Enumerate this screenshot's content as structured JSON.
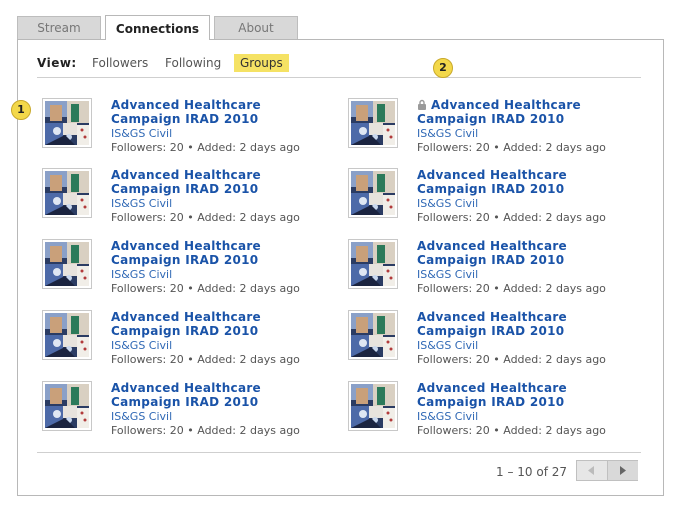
{
  "tabs": [
    "Stream",
    "Connections",
    "About"
  ],
  "view": {
    "label": "View:",
    "filters": [
      "Followers",
      "Following",
      "Groups"
    ],
    "active_filter": "Groups"
  },
  "badges": [
    "1",
    "2"
  ],
  "groups": [
    {
      "title": "Advanced Healthcare Campaign IRAD 2010",
      "org": "IS&GS Civil",
      "followers_label": "Followers:",
      "followers": "20",
      "added_label": "Added:",
      "added": "2 days ago",
      "locked": false
    },
    {
      "title": "Advanced Healthcare Campaign IRAD 2010",
      "org": "IS&GS Civil",
      "followers_label": "Followers:",
      "followers": "20",
      "added_label": "Added:",
      "added": "2 days ago",
      "locked": true
    },
    {
      "title": "Advanced Healthcare Campaign IRAD 2010",
      "org": "IS&GS Civil",
      "followers_label": "Followers:",
      "followers": "20",
      "added_label": "Added:",
      "added": "2 days ago",
      "locked": false
    },
    {
      "title": "Advanced Healthcare Campaign IRAD 2010",
      "org": "IS&GS Civil",
      "followers_label": "Followers:",
      "followers": "20",
      "added_label": "Added:",
      "added": "2 days ago",
      "locked": false
    },
    {
      "title": "Advanced Healthcare Campaign IRAD 2010",
      "org": "IS&GS Civil",
      "followers_label": "Followers:",
      "followers": "20",
      "added_label": "Added:",
      "added": "2 days ago",
      "locked": false
    },
    {
      "title": "Advanced Healthcare Campaign IRAD 2010",
      "org": "IS&GS Civil",
      "followers_label": "Followers:",
      "followers": "20",
      "added_label": "Added:",
      "added": "2 days ago",
      "locked": false
    },
    {
      "title": "Advanced Healthcare Campaign IRAD 2010",
      "org": "IS&GS Civil",
      "followers_label": "Followers:",
      "followers": "20",
      "added_label": "Added:",
      "added": "2 days ago",
      "locked": false
    },
    {
      "title": "Advanced Healthcare Campaign IRAD 2010",
      "org": "IS&GS Civil",
      "followers_label": "Followers:",
      "followers": "20",
      "added_label": "Added:",
      "added": "2 days ago",
      "locked": false
    },
    {
      "title": "Advanced Healthcare Campaign IRAD 2010",
      "org": "IS&GS Civil",
      "followers_label": "Followers:",
      "followers": "20",
      "added_label": "Added:",
      "added": "2 days ago",
      "locked": false
    },
    {
      "title": "Advanced Healthcare Campaign IRAD 2010",
      "org": "IS&GS Civil",
      "followers_label": "Followers:",
      "followers": "20",
      "added_label": "Added:",
      "added": "2 days ago",
      "locked": false
    }
  ],
  "pagination": {
    "range_text": "1 – 10 of 27",
    "prev_icon": "arrow-left-icon",
    "next_icon": "arrow-right-icon"
  },
  "colors": {
    "link": "#1a53a8",
    "org": "#2f68b5",
    "highlight": "#f5e264",
    "badge": "#f3d84a"
  }
}
